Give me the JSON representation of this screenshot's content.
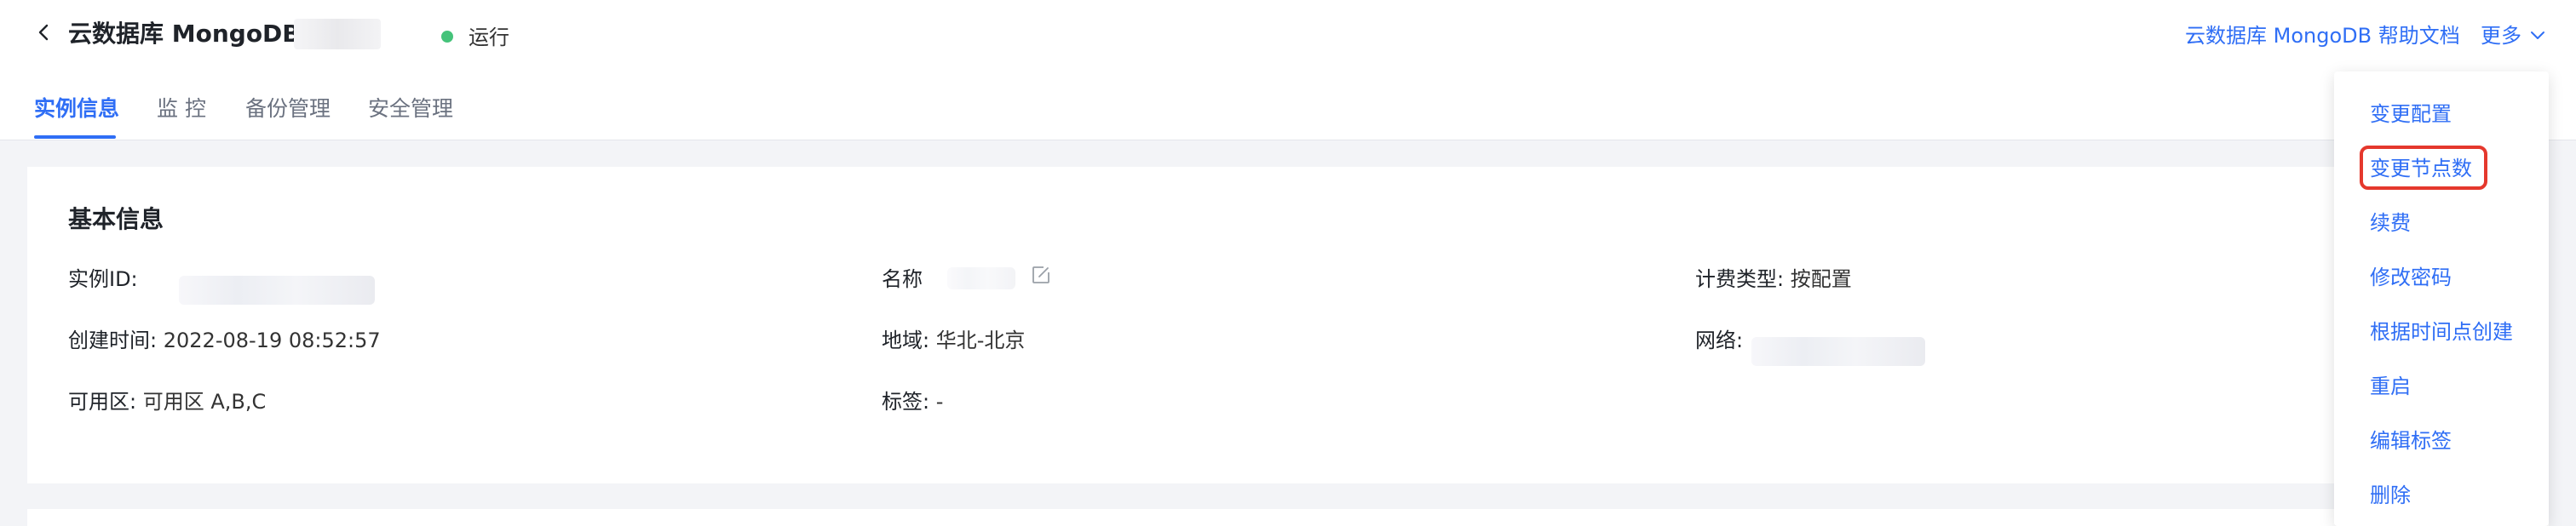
{
  "header": {
    "title": "云数据库 MongoDB",
    "status": "运行",
    "help_link": "云数据库 MongoDB 帮助文档",
    "more_label": "更多"
  },
  "tabs": [
    {
      "label": "实例信息",
      "active": true
    },
    {
      "label": "监 控",
      "active": false
    },
    {
      "label": "备份管理",
      "active": false
    },
    {
      "label": "安全管理",
      "active": false
    }
  ],
  "basic_info": {
    "title": "基本信息",
    "instance_id_label": "实例ID:",
    "name_label": "名称",
    "billing_label": "计费类型:",
    "billing_value": "按配置",
    "created_label": "创建时间:",
    "created_value": "2022-08-19 08:52:57",
    "region_label": "地域:",
    "region_value": "华北-北京",
    "network_label": "网络:",
    "zone_label": "可用区:",
    "zone_value": "可用区 A,B,C",
    "tags_label": "标签:",
    "tags_value": "-"
  },
  "more_menu": {
    "items": [
      {
        "label": "变更配置"
      },
      {
        "label": "变更节点数",
        "highlighted": true
      },
      {
        "label": "续费"
      },
      {
        "label": "修改密码"
      },
      {
        "label": "根据时间点创建"
      },
      {
        "label": "重启"
      },
      {
        "label": "编辑标签"
      },
      {
        "label": "删除"
      }
    ]
  },
  "colors": {
    "accent": "#2f6ef5",
    "status_running": "#45c37a",
    "highlight_border": "#e5382d"
  },
  "icons": {
    "back": "chevron-left-icon",
    "more": "chevron-down-icon",
    "edit": "edit-icon"
  }
}
